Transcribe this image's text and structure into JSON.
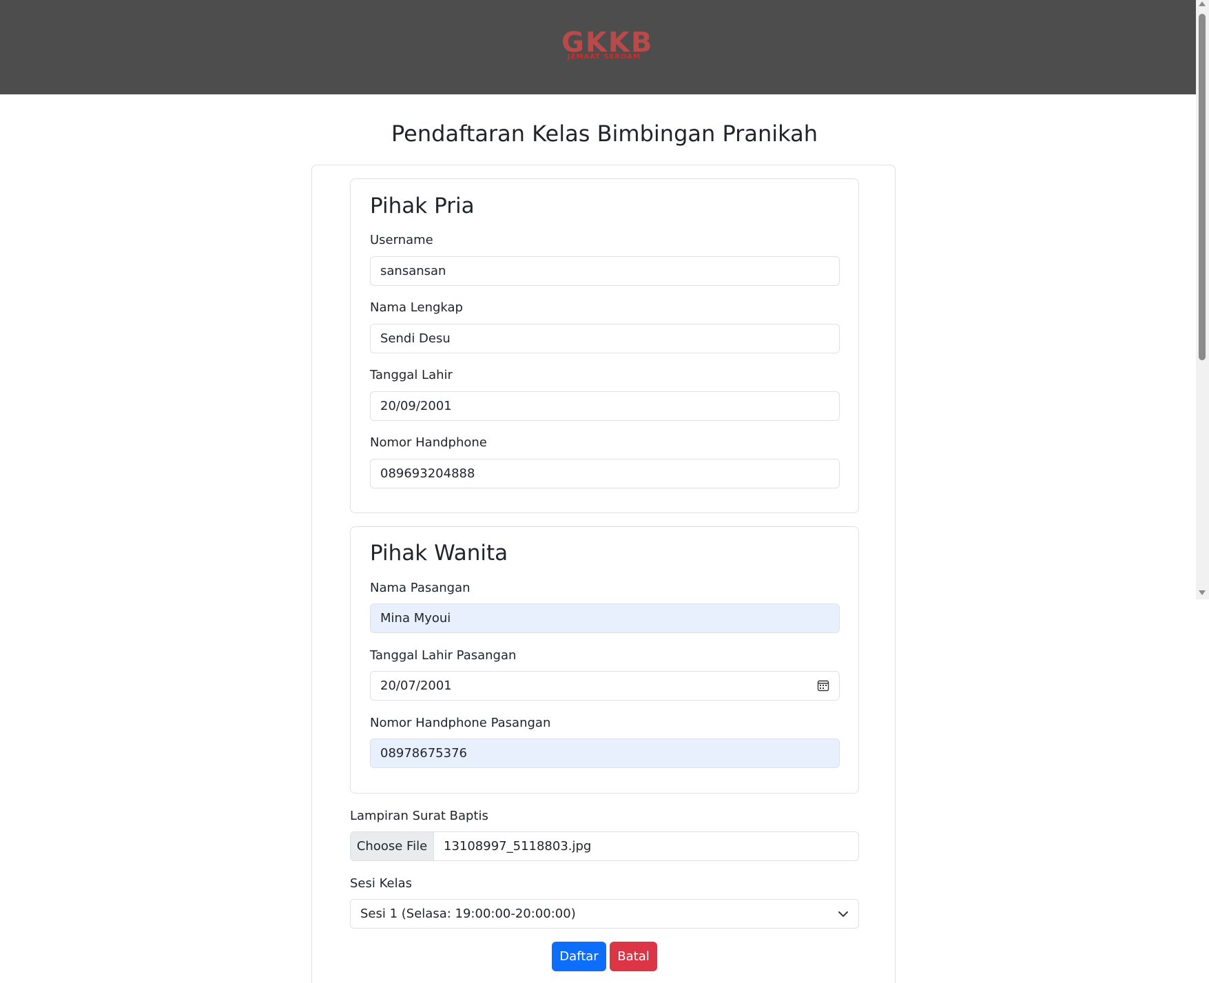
{
  "header": {
    "logo_text": "GKKB",
    "logo_subtext": "JEMAAT SEROAM"
  },
  "page_title": "Pendaftaran Kelas Bimbingan Pranikah",
  "pihak_pria": {
    "title": "Pihak Pria",
    "username_label": "Username",
    "username_value": "sansansan",
    "nama_lengkap_label": "Nama Lengkap",
    "nama_lengkap_value": "Sendi Desu",
    "tanggal_lahir_label": "Tanggal Lahir",
    "tanggal_lahir_value": "20/09/2001",
    "nomor_hp_label": "Nomor Handphone",
    "nomor_hp_value": "089693204888"
  },
  "pihak_wanita": {
    "title": "Pihak Wanita",
    "nama_pasangan_label": "Nama Pasangan",
    "nama_pasangan_value": "Mina Myoui",
    "tanggal_lahir_pasangan_label": "Tanggal Lahir Pasangan",
    "tanggal_lahir_pasangan_value": "20/07/2001",
    "nomor_hp_pasangan_label": "Nomor Handphone Pasangan",
    "nomor_hp_pasangan_value": "08978675376"
  },
  "lampiran": {
    "label": "Lampiran Surat Baptis",
    "button_label": "Choose File",
    "file_name": "13108997_5118803.jpg"
  },
  "sesi_kelas": {
    "label": "Sesi Kelas",
    "selected": "Sesi 1 (Selasa: 19:00:00-20:00:00)"
  },
  "actions": {
    "daftar_label": "Daftar",
    "batal_label": "Batal"
  },
  "colors": {
    "header_bg": "#4d4d4d",
    "logo": "#b84a4a",
    "primary": "#0d6efd",
    "danger": "#dc3545",
    "autofill_bg": "#e8f0fe"
  },
  "icons": {
    "date_picker": "calendar-icon",
    "select_dropdown": "chevron-down-icon"
  }
}
